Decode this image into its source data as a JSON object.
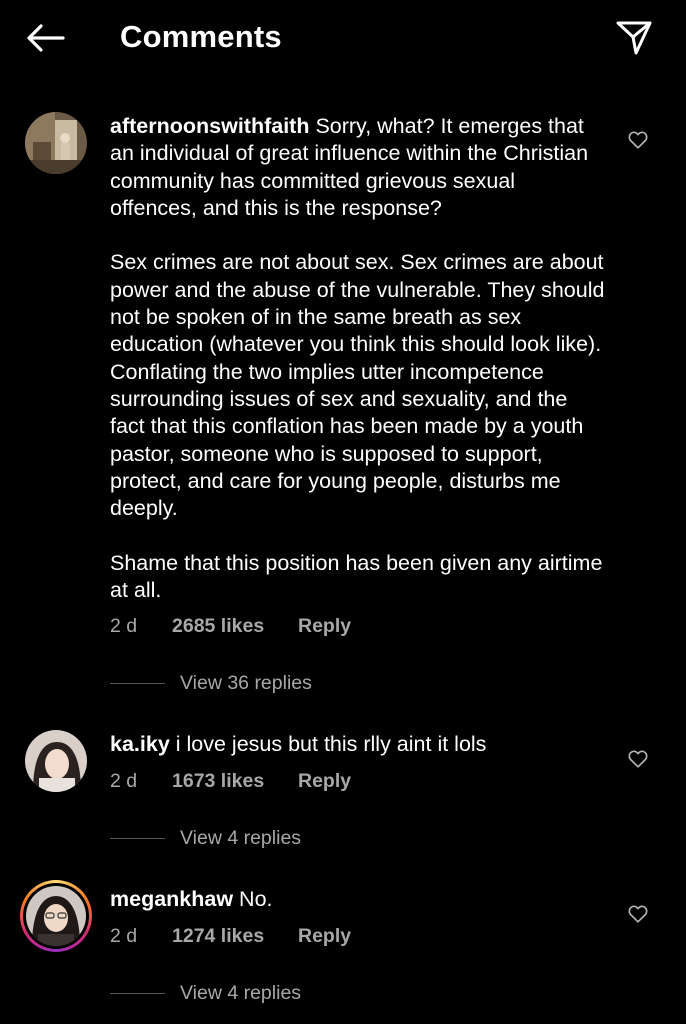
{
  "header": {
    "title": "Comments",
    "back_icon": "arrow-left-icon",
    "send_icon": "paper-plane-icon"
  },
  "comments": [
    {
      "username": "afternoonswithfaith",
      "text": " Sorry, what? It emerges that an individual of great influence within the Christian community has committed grievous sexual offences, and this is the response?\n\nSex crimes are not about sex. Sex crimes are about power and the abuse of the vulnerable. They should not be spoken of in the same breath as sex education (whatever you think this should look like). Conflating the two implies utter incompetence surrounding issues of sex and sexuality, and the fact that this conflation has been made by a youth pastor, someone who is supposed to support, protect, and care for young people, disturbs me deeply.\n\nShame that this position has been given any airtime at all.",
      "time": "2 d",
      "likes": "2685 likes",
      "reply": "Reply",
      "view_replies": "View 36 replies",
      "avatar_icon": "user-avatar"
    },
    {
      "username": "ka.iky",
      "text": " i love jesus but this rlly aint it lols",
      "time": "2 d",
      "likes": "1673 likes",
      "reply": "Reply",
      "view_replies": "View 4 replies",
      "avatar_icon": "user-avatar"
    },
    {
      "username": "megankhaw",
      "text": " No.",
      "time": "2 d",
      "likes": "1274 likes",
      "reply": "Reply",
      "view_replies": "View 4 replies",
      "avatar_icon": "user-avatar-story-ring"
    }
  ],
  "colors": {
    "background": "#000000",
    "text": "#ffffff",
    "muted": "#a8a8a8"
  }
}
